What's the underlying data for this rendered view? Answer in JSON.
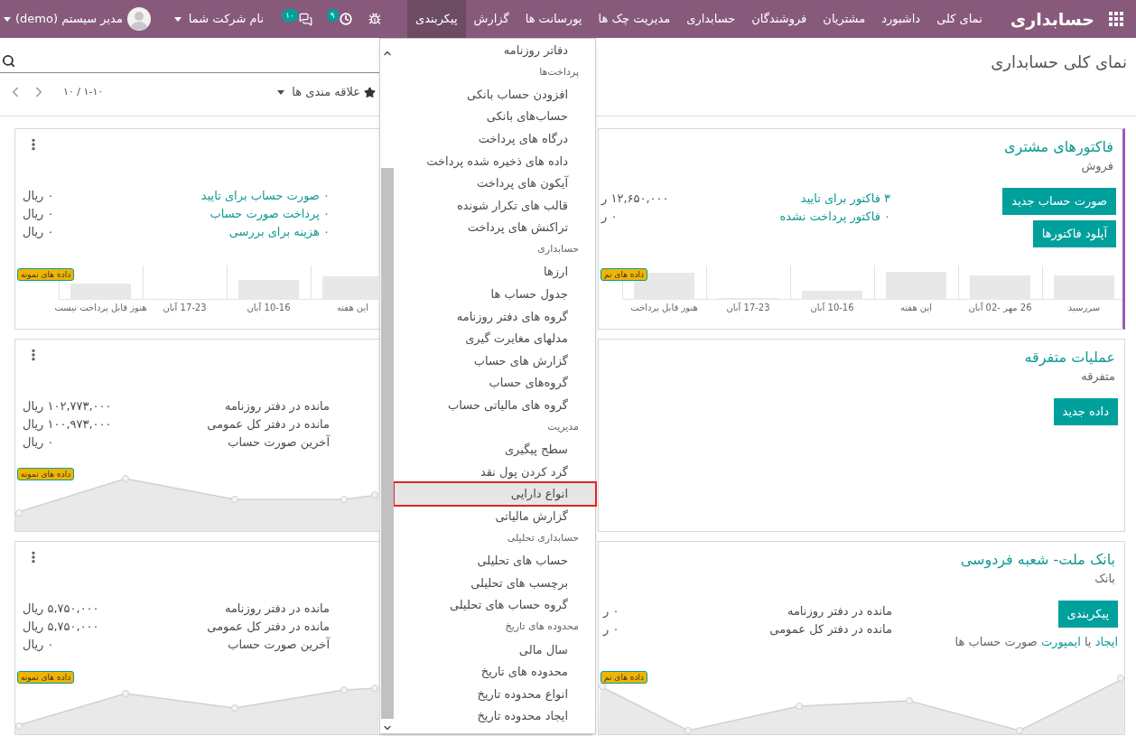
{
  "navbar": {
    "brand": "حسابداری",
    "menus": [
      {
        "label": "نمای کلی",
        "selected": false
      },
      {
        "label": "داشبورد",
        "selected": false
      },
      {
        "label": "مشتریان",
        "selected": false
      },
      {
        "label": "فروشندگان",
        "selected": false
      },
      {
        "label": "حسابداری",
        "selected": false
      },
      {
        "label": "مدیریت چک ها",
        "selected": false
      },
      {
        "label": "پورسانت ها",
        "selected": false
      },
      {
        "label": "گزارش",
        "selected": false
      },
      {
        "label": "پیکربندی",
        "selected": true
      }
    ],
    "activity_count": "۹",
    "message_count": "۱۰",
    "company": "نام شرکت شما",
    "user": "مدیر سیستم (demo)"
  },
  "control_panel": {
    "title": "نمای کلی حسابداری",
    "favorites": "علاقه مندی ها",
    "pager": "۱-۱۰ / ۱۰"
  },
  "dashboard": {
    "right_cards": [
      {
        "title": "فاکتورهای مشتری",
        "subtitle": "فروش",
        "highlighted": true,
        "buttons": [
          "صورت حساب جدید",
          "آپلود فاکتورها"
        ],
        "stats": [
          {
            "label": "۳ فاکتور برای تایید",
            "amount": "۱۲,۶۵۰,۰۰۰ ر",
            "link": true
          },
          {
            "label": "۰ فاکتور پرداخت نشده",
            "amount": "۰ ر",
            "link": true
          }
        ],
        "chart": {
          "kind": "bars",
          "sample_badge": "داده های نم",
          "labels": [
            "سررسید",
            "26 مهر -02 آبان",
            "این هفته",
            "10-16 آبان",
            "17-23 آبان",
            "هنوز قابل پرداخت"
          ]
        }
      },
      {
        "title": "عملیات متفرقه",
        "subtitle": "متفرقه",
        "highlighted": false,
        "buttons": [
          "داده جدید"
        ]
      },
      {
        "title": "بانک ملت- شعبه فردوسی",
        "subtitle": "بانک",
        "highlighted": false,
        "buttons": [
          "پیکربندی"
        ],
        "hint": {
          "create_link": "ایجاد",
          "connector": "یا",
          "import_link": "ایمپورت",
          "rest": "صورت حساب ها"
        },
        "stats": [
          {
            "label": "مانده در دفتر روزنامه",
            "amount": "۰ ر",
            "link": false
          },
          {
            "label": "مانده در دفتر کل عمومی",
            "amount": "۰ ر",
            "link": false
          }
        ],
        "chart": {
          "kind": "area",
          "sample_badge": "داده های نم"
        }
      }
    ],
    "left_cards": [
      {
        "stats": [
          {
            "label": "۰ صورت حساب برای تایید",
            "amount": "۰ ریال",
            "link": true
          },
          {
            "label": "۰ پرداخت صورت حساب",
            "amount": "۰ ریال",
            "link": true
          },
          {
            "label": "۰ هزینه برای بررسی",
            "amount": "۰ ریال",
            "link": true
          }
        ],
        "chart": {
          "kind": "bars",
          "sample_badge": "داده های نمونه",
          "labels": [
            "این هفته",
            "10-16 آبان",
            "17-23 آبان",
            "هنوز قابل پرداخت نیست"
          ]
        }
      },
      {
        "stats": [
          {
            "label": "مانده در دفتر روزنامه",
            "amount": "۱۰۲,۷۷۳,۰۰۰ ریال",
            "link": false
          },
          {
            "label": "مانده در دفتر کل عمومی",
            "amount": "۱۰۰,۹۷۳,۰۰۰ ریال",
            "link": false
          },
          {
            "label": "آخرین صورت حساب",
            "amount": "۰ ریال",
            "link": false
          }
        ],
        "chart": {
          "kind": "area",
          "sample_badge": "داده های نمونه"
        }
      },
      {
        "stats": [
          {
            "label": "مانده در دفتر روزنامه",
            "amount": "۵,۷۵۰,۰۰۰ ریال",
            "link": false
          },
          {
            "label": "مانده در دفتر کل عمومی",
            "amount": "۵,۷۵۰,۰۰۰ ریال",
            "link": false
          },
          {
            "label": "آخرین صورت حساب",
            "amount": "۰ ریال",
            "link": false
          }
        ],
        "chart": {
          "kind": "area",
          "sample_badge": "داده های نمونه"
        }
      }
    ]
  },
  "dropdown": {
    "items": [
      {
        "kind": "item",
        "label": "دفاتر روزنامه",
        "selected": false
      },
      {
        "kind": "header",
        "label": "پرداخت‌ها"
      },
      {
        "kind": "item",
        "label": "افزودن حساب بانکی",
        "selected": false
      },
      {
        "kind": "item",
        "label": "حساب‌های بانکی",
        "selected": false
      },
      {
        "kind": "item",
        "label": "درگاه های پرداخت",
        "selected": false
      },
      {
        "kind": "item",
        "label": "داده های ذخیره شده پرداخت",
        "selected": false
      },
      {
        "kind": "item",
        "label": "آیکون های پرداخت",
        "selected": false
      },
      {
        "kind": "item",
        "label": "قالب های تکرار شونده",
        "selected": false
      },
      {
        "kind": "item",
        "label": "تراکنش های پرداخت",
        "selected": false
      },
      {
        "kind": "header",
        "label": "حسابداری"
      },
      {
        "kind": "item",
        "label": "ارزها",
        "selected": false
      },
      {
        "kind": "item",
        "label": "جدول حساب ها",
        "selected": false
      },
      {
        "kind": "item",
        "label": "گروه های دفتر روزنامه",
        "selected": false
      },
      {
        "kind": "item",
        "label": "مدلهای مغایرت گیری",
        "selected": false
      },
      {
        "kind": "item",
        "label": "گزارش های حساب",
        "selected": false
      },
      {
        "kind": "item",
        "label": "گروه‌های حساب",
        "selected": false
      },
      {
        "kind": "item",
        "label": "گروه های مالیاتی حساب",
        "selected": false
      },
      {
        "kind": "header",
        "label": "مدیریت"
      },
      {
        "kind": "item",
        "label": "سطح پیگیری",
        "selected": false
      },
      {
        "kind": "item",
        "label": "گرد کردن پول نقد",
        "selected": false
      },
      {
        "kind": "item",
        "label": "انواع دارایی",
        "selected": true
      },
      {
        "kind": "item",
        "label": "گزارش مالیاتی",
        "selected": false
      },
      {
        "kind": "header",
        "label": "حسابداری تحلیلی"
      },
      {
        "kind": "item",
        "label": "حساب های تحلیلی",
        "selected": false
      },
      {
        "kind": "item",
        "label": "برچسب های تحلیلی",
        "selected": false
      },
      {
        "kind": "item",
        "label": "گروه حساب های تحلیلی",
        "selected": false
      },
      {
        "kind": "header",
        "label": "محدوده های تاریخ"
      },
      {
        "kind": "item",
        "label": "سال مالی",
        "selected": false
      },
      {
        "kind": "item",
        "label": "محدوده های تاریخ",
        "selected": false
      },
      {
        "kind": "item",
        "label": "انواع محدوده تاریخ",
        "selected": false
      },
      {
        "kind": "item",
        "label": "ایجاد محدوده تاریخ",
        "selected": false
      }
    ]
  }
}
